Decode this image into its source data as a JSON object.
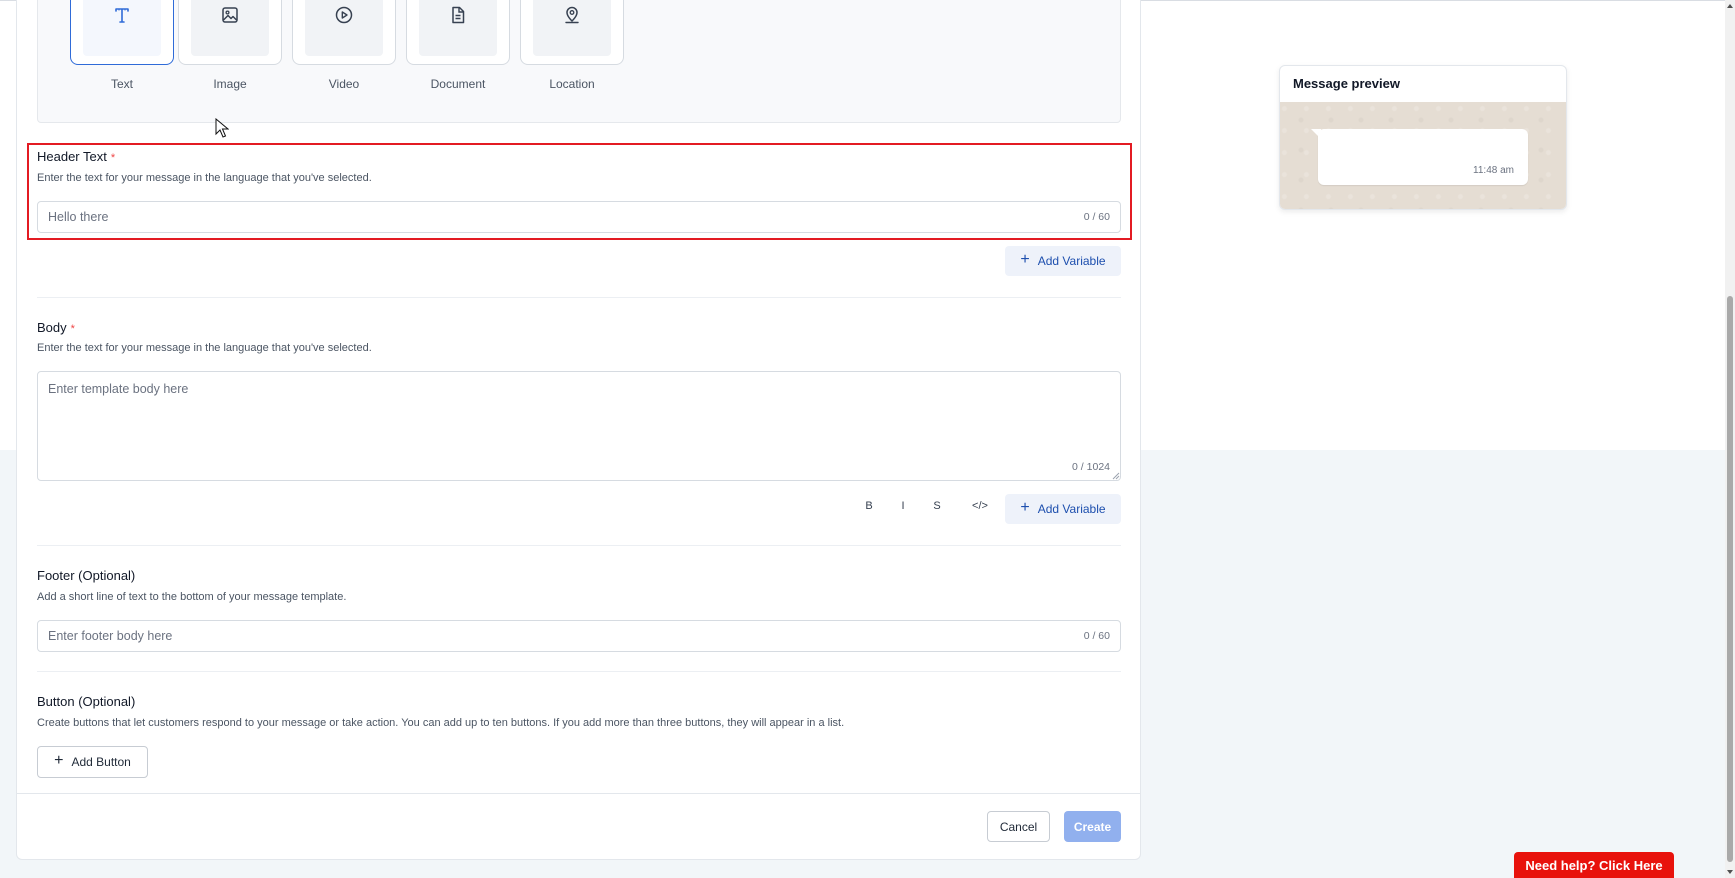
{
  "media_options": [
    {
      "label": "Text",
      "icon": "text-icon",
      "selected": true
    },
    {
      "label": "Image",
      "icon": "image-icon",
      "selected": false
    },
    {
      "label": "Video",
      "icon": "video-icon",
      "selected": false
    },
    {
      "label": "Document",
      "icon": "document-icon",
      "selected": false
    },
    {
      "label": "Location",
      "icon": "location-icon",
      "selected": false
    }
  ],
  "header_text": {
    "label": "Header Text",
    "required_mark": "*",
    "hint": "Enter the text for your message in the language that you've selected.",
    "placeholder": "Hello there",
    "counter": "0 / 60",
    "add_variable_label": "Add Variable"
  },
  "body": {
    "label": "Body",
    "required_mark": "*",
    "hint": "Enter the text for your message in the language that you've selected.",
    "placeholder": "Enter template body here",
    "counter": "0 / 1024",
    "format_buttons": {
      "bold": "B",
      "italic": "I",
      "strike": "S",
      "code": "</>"
    },
    "add_variable_label": "Add Variable"
  },
  "footer": {
    "label": "Footer (Optional)",
    "hint": "Add a short line of text to the bottom of your message template.",
    "placeholder": "Enter footer body here",
    "counter": "0 / 60"
  },
  "buttons": {
    "label": "Button (Optional)",
    "hint": "Create buttons that let customers respond to your message or take action. You can add up to ten buttons. If you add more than three buttons, they will appear in a list.",
    "add_button_label": "Add Button"
  },
  "actions": {
    "cancel_label": "Cancel",
    "create_label": "Create"
  },
  "preview": {
    "title": "Message preview",
    "time": "11:48 am"
  },
  "help": {
    "label": "Need help? Click Here"
  },
  "colors": {
    "accent": "#2f6bd8",
    "required": "#ef4444",
    "highlight": "#e31b23",
    "help": "#e8120c",
    "create_disabled": "#91b0ee"
  }
}
